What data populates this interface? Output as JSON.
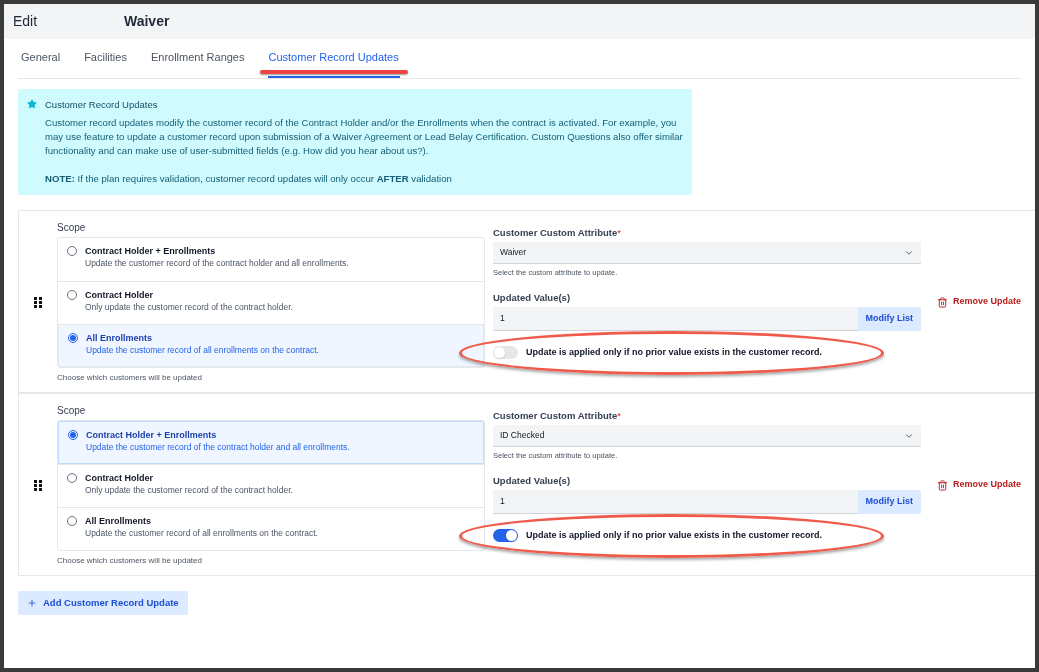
{
  "header": {
    "action": "Edit",
    "title": "Waiver"
  },
  "tabs": [
    {
      "label": "General",
      "selected": false,
      "underlined": false
    },
    {
      "label": "Facilities",
      "selected": false,
      "underlined": false
    },
    {
      "label": "Enrollment Ranges",
      "selected": false,
      "underlined": false
    },
    {
      "label": "Customer Record Updates",
      "selected": true,
      "underlined": true
    }
  ],
  "info": {
    "title": "Customer Record Updates",
    "body": "Customer record updates modify the customer record of the Contract Holder and/or the Enrollments when the contract is activated. For example, you may use feature to update a customer record upon submission of a Waiver Agreement or Lead Belay Certification. Custom Questions also offer similar functionality and can make use of user-submitted fields (e.g. How did you hear about us?).",
    "note": "**NOTE:** If the plan requires validation, customer record updates will only occur **AFTER** validation"
  },
  "updates": [
    {
      "scope_label": "Scope",
      "options": [
        {
          "title": "Contract Holder + Enrollments",
          "desc": "Update the customer record of the contract holder and all enrollments.",
          "selected": false
        },
        {
          "title": "Contract Holder",
          "desc": "Only update the customer record of the contract holder.",
          "selected": false
        },
        {
          "title": "All Enrollments",
          "desc": "Update the customer record of all enrollments on the contract.",
          "selected": true
        }
      ],
      "scope_hint": "Choose which customers will be updated",
      "attribute_label": "Customer Custom Attribute",
      "required_mark": "*",
      "attribute_value": "Waiver",
      "attribute_hint": "Select the custom attribute to update.",
      "values_label": "Updated Value(s)",
      "values_value": "1",
      "modify_button": "Modify List",
      "toggle": {
        "label": "Update is applied only if no prior value exists in the customer record.",
        "on": false,
        "circled": true
      },
      "remove_button": "Remove Update"
    },
    {
      "scope_label": "Scope",
      "options": [
        {
          "title": "Contract Holder + Enrollments",
          "desc": "Update the customer record of the contract holder and all enrollments.",
          "selected": true
        },
        {
          "title": "Contract Holder",
          "desc": "Only update the customer record of the contract holder.",
          "selected": false
        },
        {
          "title": "All Enrollments",
          "desc": "Update the customer record of all enrollments on the contract.",
          "selected": false
        }
      ],
      "scope_hint": "Choose which customers will be updated",
      "attribute_label": "Customer Custom Attribute",
      "required_mark": "*",
      "attribute_value": "ID Checked",
      "attribute_hint": "Select the custom attribute to update.",
      "values_label": "Updated Value(s)",
      "values_value": "1",
      "modify_button": "Modify List",
      "toggle": {
        "label": "Update is applied only if no prior value exists in the customer record.",
        "on": true,
        "circled": true
      },
      "remove_button": "Remove Update"
    }
  ],
  "add_button": "Add Customer Record Update"
}
